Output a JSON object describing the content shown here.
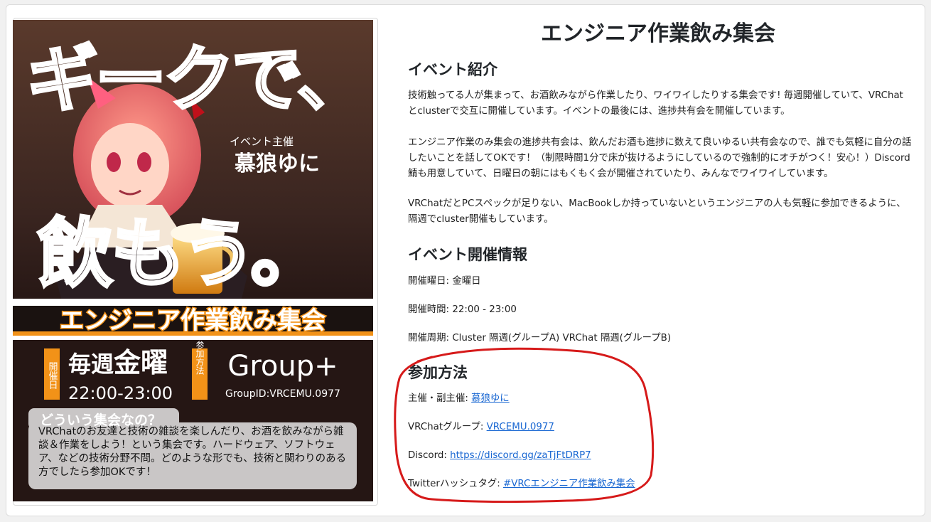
{
  "page": {
    "title": "エンジニア作業飲み集会"
  },
  "intro": {
    "heading": "イベント紹介",
    "p1": "技術触ってる人が集まって、お酒飲みながら作業したり、ワイワイしたりする集会です! 毎週開催していて、VRChatとclusterで交互に開催しています。イベントの最後には、進捗共有会を開催しています。",
    "p2": "エンジニア作業のみ集会の進捗共有会は、飲んだお酒も進捗に数えて良いゆるい共有会なので、誰でも気軽に自分の話したいことを話してOKです！（制限時間1分で床が抜けるようにしているので強制的にオチがつく！安心！）Discord鯖も用意していて、日曜日の朝にはもくもく会が開催されていたり、みんなでワイワイしています。",
    "p3": "VRChatだとPCスペックが足りない、MacBookしか持っていないというエンジニアの人も気軽に参加できるように、隔週でcluster開催もしています。"
  },
  "info": {
    "heading": "イベント開催情報",
    "day": "開催曜日: 金曜日",
    "time": "開催時間: 22:00 - 23:00",
    "cycle": "開催周期: Cluster 隔週(グループA) VRChat 隔週(グループB)"
  },
  "join": {
    "heading": "参加方法",
    "host_label": "主催・副主催: ",
    "host_link": "慕狼ゆに",
    "group_label": "VRChatグループ: ",
    "group_link": "VRCEMU.0977",
    "discord_label": "Discord: ",
    "discord_link": "https://discord.gg/zaTjFtDRP7",
    "twitter_label": "Twitterハッシュタグ: ",
    "twitter_link": "#VRCエンジニア作業飲み集会"
  },
  "poster": {
    "headline_top": "ギークで、",
    "headline_bottom": "飲もう。",
    "host_caption": "イベント主催",
    "host_name": "慕狼ゆに",
    "event_title": "エンジニア作業飲み集会",
    "day_tag": "開催日",
    "weekly": "毎週",
    "weekday": "金曜",
    "hours": "22:00-23:00",
    "join_tag": "参加方法",
    "group": "Group+",
    "group_id": "GroupID:VRCEMU.0977",
    "what_heading": "どういう集会なの？",
    "what_body": "VRChatのお友達と技術の雑談を楽しんだり、お酒を飲みながら雑談＆作業をしよう！という集会です。ハードウェア、ソフトウェア、などの技術分野不問。どのような形でも、技術と関わりのある方でしたら参加OKです！"
  },
  "colors": {
    "accent_orange": "#f29218",
    "link_blue": "#1967d2",
    "highlight_red": "#d61a1a"
  }
}
